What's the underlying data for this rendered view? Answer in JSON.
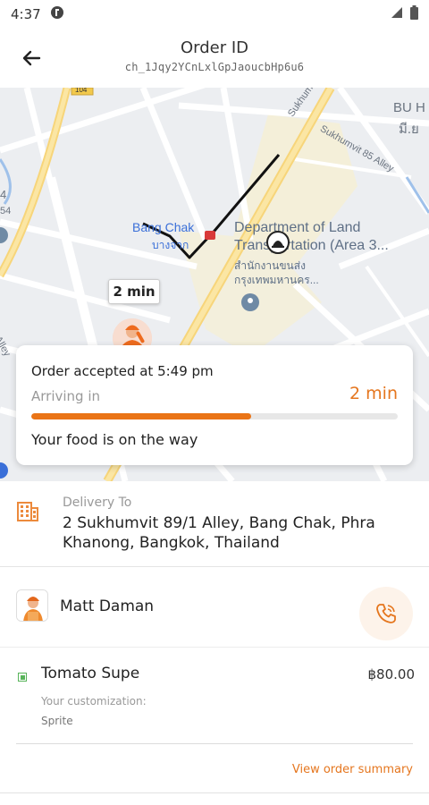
{
  "status_bar": {
    "time": "4:37"
  },
  "header": {
    "title": "Order ID",
    "order_id": "ch_1Jqy2YCnLxlGpJaoucbHp6u6"
  },
  "map": {
    "labels": {
      "bu_h": "BU H",
      "thai_corner": "มี.ย",
      "sukhumvit_road": "Sukhumvit Ro",
      "sukhumvit_85": "Sukhumvit 85 Alley",
      "dlt_en_1": "Department of Land",
      "dlt_en_2": "Transportation (Area 3...",
      "dlt_th_1": "สำนักงานขนส่ง",
      "dlt_th_2": "กรุงเทพมหานคร...",
      "bang_chak": "Bang Chak",
      "bang_chak_th": "บางจาก",
      "road_104": "104",
      "alley": "Alley",
      "left_4": "4",
      "left_54": "54"
    },
    "eta_bubble": "2 min"
  },
  "status_card": {
    "accepted_text": "Order accepted at 5:49 pm",
    "arriving_label": "Arriving in",
    "arriving_value": "2 min",
    "progress": 0.6,
    "message": "Your food is on the way"
  },
  "delivery": {
    "label": "Delivery To",
    "address": "2 Sukhumvit 89/1 Alley, Bang Chak, Phra Khanong, Bangkok, Thailand"
  },
  "rider": {
    "name": "Matt Daman"
  },
  "order_item": {
    "name": "Tomato Supe",
    "price": "฿80.00",
    "customization_label": "Your customization:",
    "customization_value": "Sprite"
  },
  "summary_link": "View order summary",
  "colors": {
    "accent": "#e5761e",
    "veg": "#58b45a"
  }
}
